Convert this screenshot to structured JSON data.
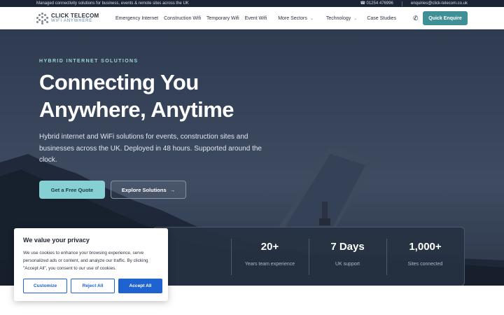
{
  "topbar": {
    "tagline": "Managed connectivity solutions for business, events & remote sites across the UK",
    "phone": "01254 476996",
    "email": "enquiries@click-telecom.co.uk"
  },
  "header": {
    "logo_line1": "CLICK TELECOM",
    "logo_line2": "WIFI ANYWHERE",
    "nav": [
      {
        "label": "Emergency Internet"
      },
      {
        "label": "Construction Wifi"
      },
      {
        "label": "Temporary Wifi"
      },
      {
        "label": "Event Wifi"
      },
      {
        "label": "More Sectors"
      },
      {
        "label": "Technology"
      },
      {
        "label": "Case Studies"
      }
    ],
    "enquire_label": "Quick Enquire"
  },
  "hero": {
    "eyebrow": "HYBRID INTERNET SOLUTIONS",
    "headline": "Connecting You Anywhere, Anytime",
    "subtext": "Hybrid internet and WiFi solutions for events, construction sites and businesses across the UK. Deployed in 48 hours. Supported around the clock.",
    "primary_cta": "Get a Free Quote",
    "secondary_cta": "Explore Solutions"
  },
  "stats": [
    {
      "value": "",
      "label": ""
    },
    {
      "value": "20+",
      "label": "Years team experience"
    },
    {
      "value": "7 Days",
      "label": "UK support"
    },
    {
      "value": "1,000+",
      "label": "Sites connected"
    }
  ],
  "cookie": {
    "title": "We value your privacy",
    "body": "We use cookies to enhance your browsing experience, serve personalized ads or content, and analyze our traffic. By clicking \"Accept All\", you consent to our use of cookies.",
    "customize": "Customize",
    "reject": "Reject All",
    "accept": "Accept All"
  },
  "icons": {
    "phone": "phone-icon",
    "chevron": "chevron-down-icon",
    "arrow": "arrow-right-icon"
  },
  "colors": {
    "accent": "#3f8f97",
    "cta": "#86cfd2",
    "cookie_blue": "#1f63d0",
    "topbar": "#1b2434"
  }
}
